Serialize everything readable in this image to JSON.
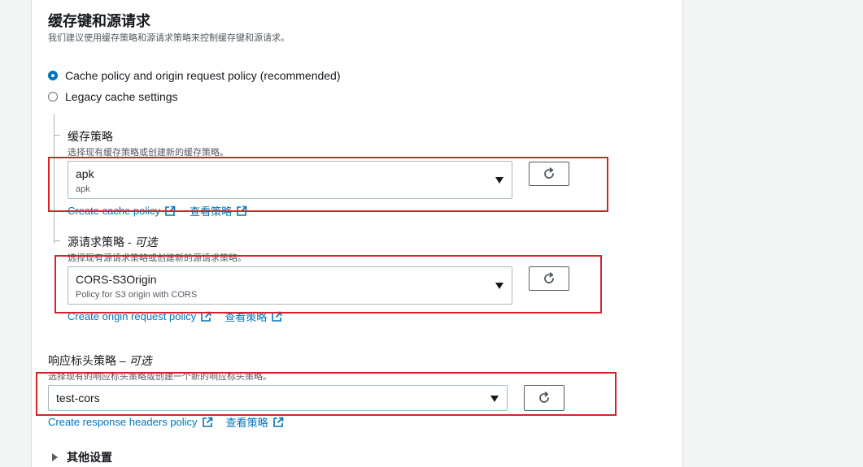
{
  "section": {
    "title": "缓存键和源请求",
    "description": "我们建议使用缓存策略和源请求策略来控制缓存键和源请求。"
  },
  "options": {
    "recommended_label": "Cache policy and origin request policy (recommended)",
    "legacy_label": "Legacy cache settings",
    "selected": "recommended"
  },
  "cache_policy": {
    "label": "缓存策略",
    "description": "选择现有缓存策略或创建新的缓存策略。",
    "selected_value": "apk",
    "selected_sub": "apk",
    "create_link": "Create cache policy",
    "view_link": "查看策略"
  },
  "origin_request_policy": {
    "label": "源请求策略 - ",
    "optional": "可选",
    "description": "选择现有源请求策略或创建新的源请求策略。",
    "selected_value": "CORS-S3Origin",
    "selected_sub": "Policy for S3 origin with CORS",
    "create_link": "Create origin request policy",
    "view_link": "查看策略"
  },
  "response_headers_policy": {
    "label": "响应标头策略 – ",
    "optional": "可选",
    "description": "选择现有的响应标头策略或创建一个新的响应标头策略。",
    "selected_value": "test-cors",
    "create_link": "Create response headers policy",
    "view_link": "查看策略"
  },
  "additional_settings": {
    "label": "其他设置"
  },
  "colors": {
    "link": "#0073bb",
    "highlight_box": "#d8222a",
    "radio_selected": "#0073bb"
  },
  "icons": {
    "refresh": "refresh-icon",
    "external_link": "external-link-icon",
    "dropdown": "caret-down-icon",
    "expand": "caret-right-icon"
  }
}
